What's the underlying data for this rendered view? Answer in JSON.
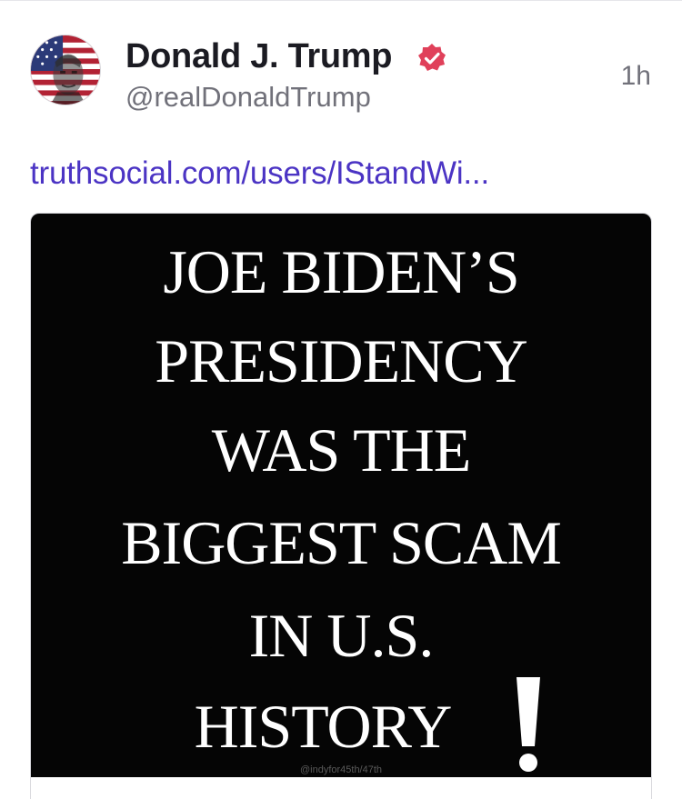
{
  "post": {
    "author": {
      "display_name": "Donald J. Trump",
      "handle": "@realDonaldTrump",
      "verified": true,
      "avatar_icon": "avatar-flag-portrait"
    },
    "timestamp": "1h",
    "link_text": "truthsocial.com/users/IStandWi...",
    "media": {
      "lines": [
        "JOE BIDEN’S",
        "PRESIDENCY",
        "WAS THE",
        "BIGGEST SCAM",
        "IN U.S.",
        "HISTORY"
      ],
      "exclamation": "!",
      "watermark": "@indyfor45th/47th"
    }
  },
  "colors": {
    "link": "#4b34c4",
    "verified_badge": "#e0405a",
    "media_background": "#050505",
    "name_text": "#1b1b22",
    "secondary_text": "#71717a"
  }
}
